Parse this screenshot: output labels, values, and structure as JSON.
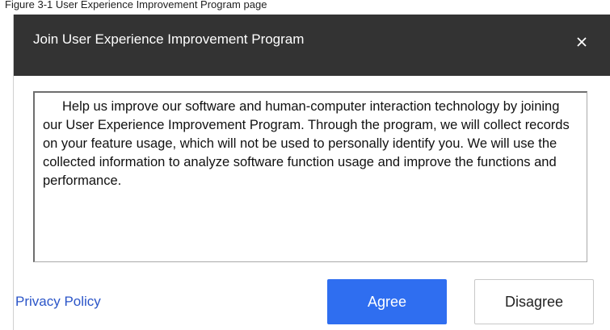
{
  "caption": {
    "text": "Figure 3-1 User Experience Improvement Program page"
  },
  "dialog": {
    "title": "Join User Experience Improvement Program",
    "close_icon": "close-icon",
    "body": "Help us improve our software and human-computer interaction technology by joining our User Experience Improvement Program. Through the program, we will collect records on your feature usage, which will not be used to personally identify you. We will use the collected information to analyze software function usage and improve the functions and performance.",
    "privacy_link": "Privacy Policy",
    "agree_label": "Agree",
    "disagree_label": "Disagree"
  },
  "colors": {
    "title_bar": "#333333",
    "accent": "#2f6ef0",
    "link": "#2b55c8"
  }
}
